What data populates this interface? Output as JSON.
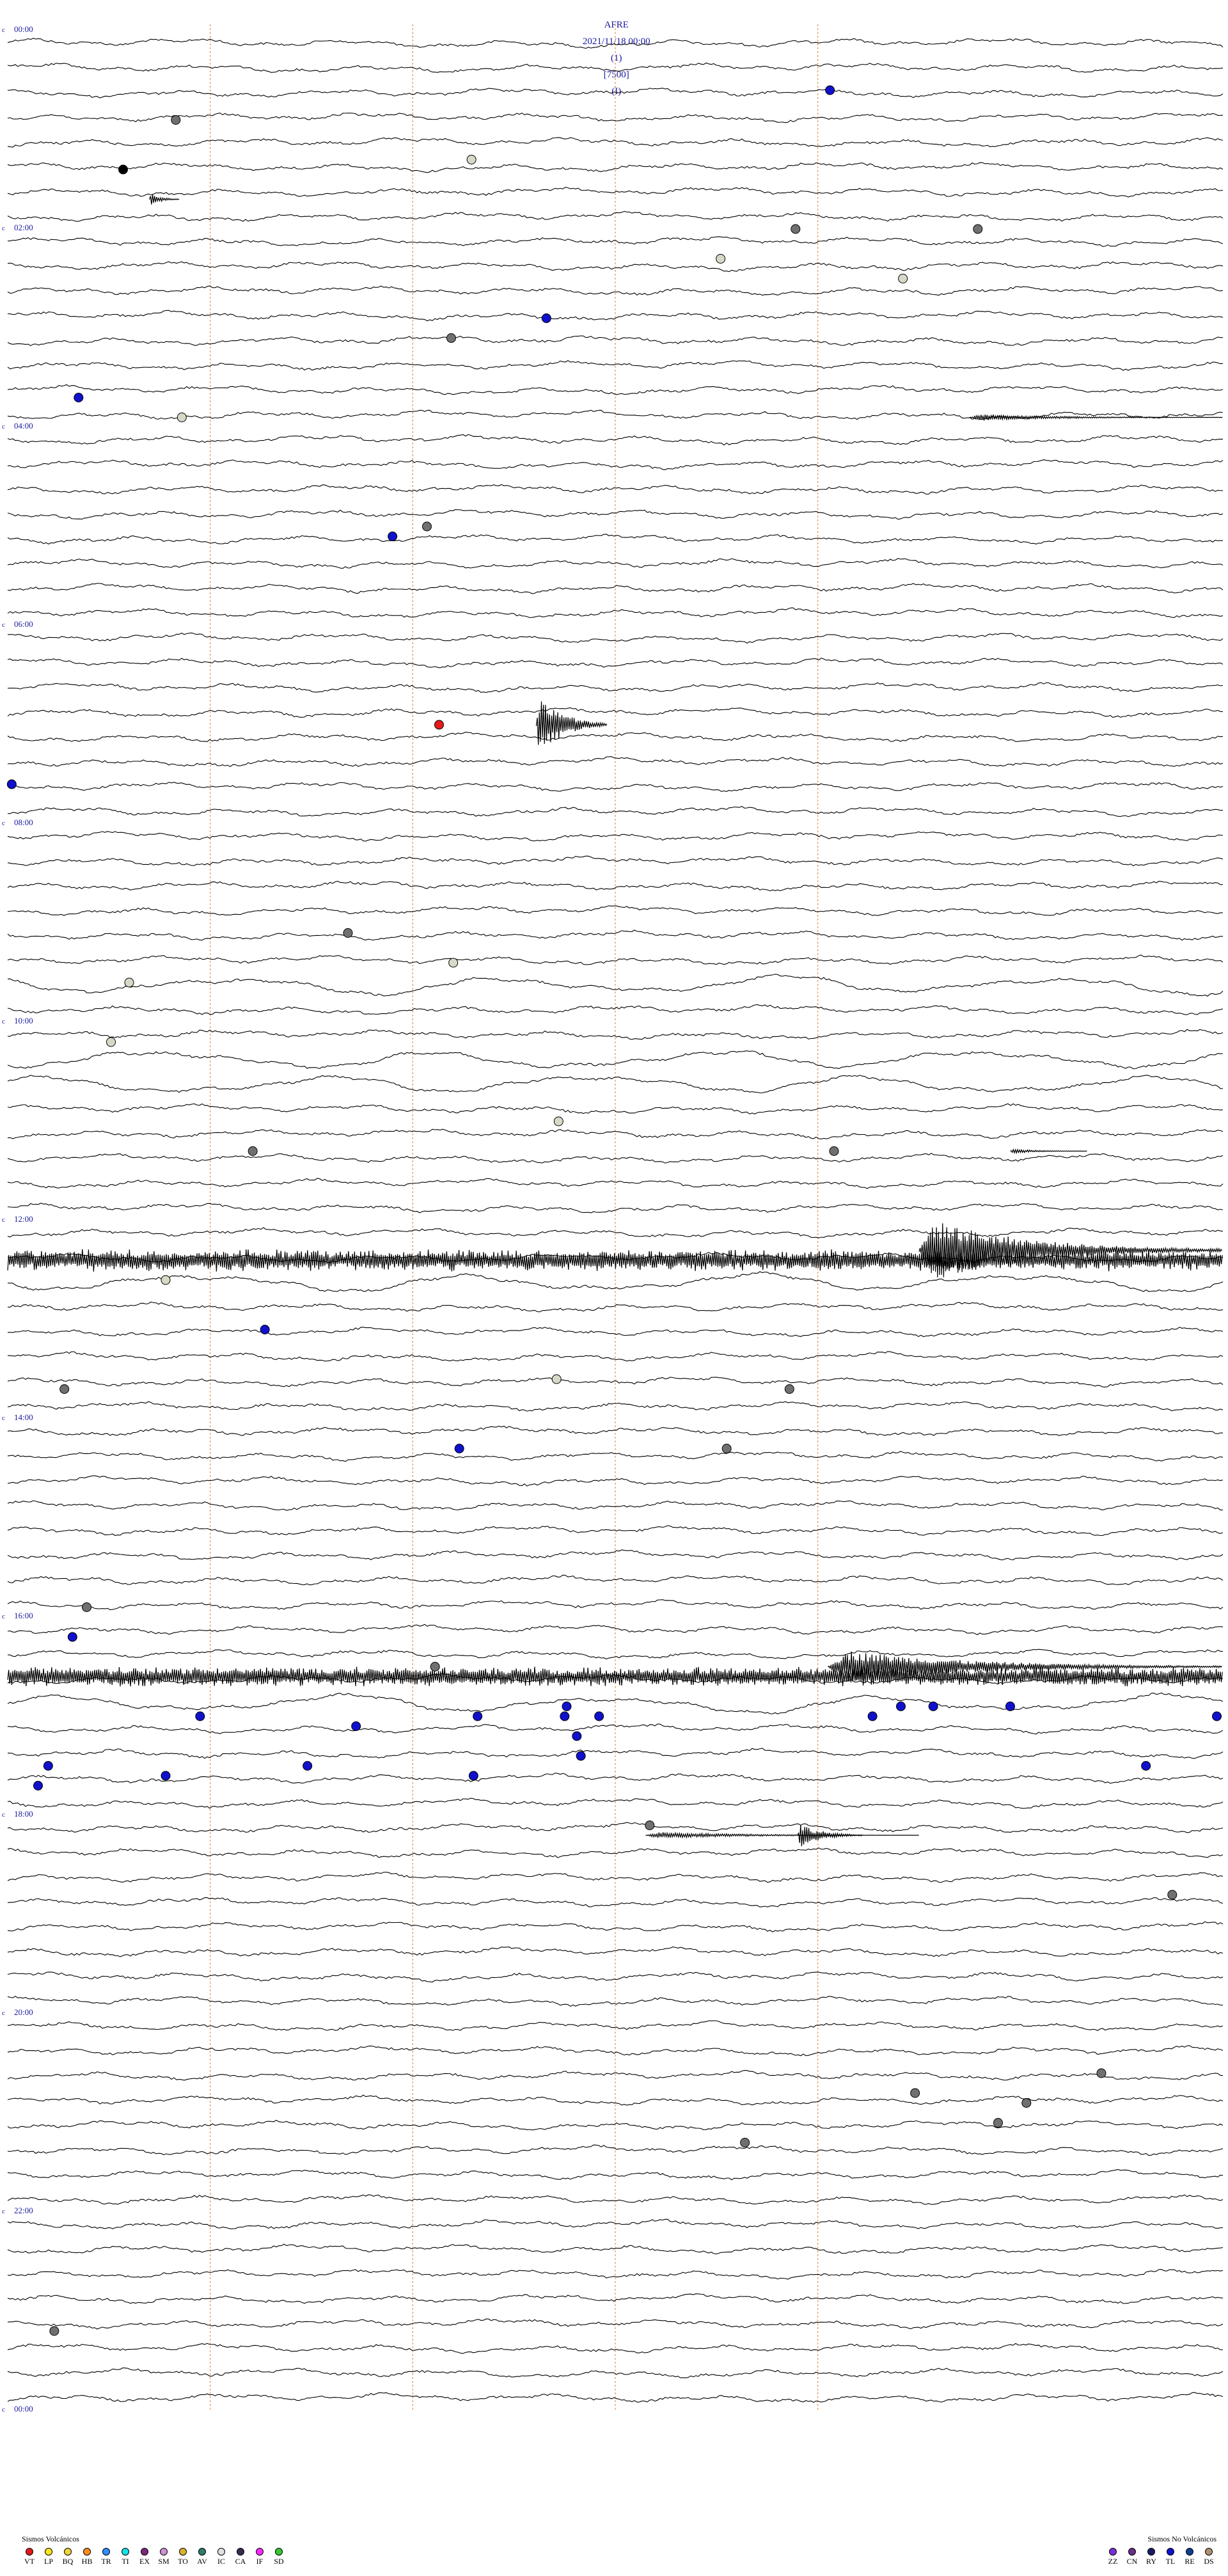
{
  "header": {
    "station": "AFRE",
    "datetime": "2021/11/18 00:00",
    "channel": "(1)",
    "scale": "[7500]",
    "mode": "(I)"
  },
  "chart_data": {
    "type": "helicorder",
    "title": "AFRE 2021/11/18 00:00 (1) [7500] (I)",
    "hour_labels": [
      "00:00",
      "02:00",
      "04:00",
      "06:00",
      "08:00",
      "10:00",
      "12:00",
      "14:00",
      "16:00",
      "18:00",
      "20:00",
      "22:00",
      "00:00"
    ],
    "x_range_minutes": [
      0,
      60
    ],
    "minute_markers": [
      10,
      20,
      30,
      40
    ],
    "trace_count": 96,
    "events": [
      {
        "hour": 0.6,
        "minute": 40.6,
        "class": "TL"
      },
      {
        "hour": 0.9,
        "minute": 8.3,
        "class": "DS"
      },
      {
        "hour": 1.3,
        "minute": 22.9,
        "class": "IC"
      },
      {
        "hour": 1.4,
        "minute": 5.7,
        "class": "EVT"
      },
      {
        "hour": 2.0,
        "minute": 47.9,
        "class": "DS"
      },
      {
        "hour": 2.0,
        "minute": 38.9,
        "class": "DS"
      },
      {
        "hour": 2.3,
        "minute": 35.2,
        "class": "IC"
      },
      {
        "hour": 2.5,
        "minute": 44.2,
        "class": "IC"
      },
      {
        "hour": 2.9,
        "minute": 26.6,
        "class": "TL"
      },
      {
        "hour": 3.1,
        "minute": 21.9,
        "class": "DS"
      },
      {
        "hour": 3.7,
        "minute": 3.5,
        "class": "TL"
      },
      {
        "hour": 3.9,
        "minute": 8.6,
        "class": "IC"
      },
      {
        "hour": 5.0,
        "minute": 20.7,
        "class": "DS"
      },
      {
        "hour": 5.1,
        "minute": 19.0,
        "class": "TL"
      },
      {
        "hour": 7.0,
        "minute": 21.3,
        "class": "VT"
      },
      {
        "hour": 7.6,
        "minute": 0.2,
        "class": "TL"
      },
      {
        "hour": 9.1,
        "minute": 16.8,
        "class": "DS"
      },
      {
        "hour": 9.4,
        "minute": 22.0,
        "class": "IC"
      },
      {
        "hour": 9.6,
        "minute": 6.0,
        "class": "IC"
      },
      {
        "hour": 10.2,
        "minute": 5.1,
        "class": "IC"
      },
      {
        "hour": 11.0,
        "minute": 27.2,
        "class": "IC"
      },
      {
        "hour": 11.3,
        "minute": 12.1,
        "class": "DS"
      },
      {
        "hour": 11.3,
        "minute": 40.8,
        "class": "DS"
      },
      {
        "hour": 12.6,
        "minute": 7.8,
        "class": "IC"
      },
      {
        "hour": 13.1,
        "minute": 12.7,
        "class": "TL"
      },
      {
        "hour": 13.6,
        "minute": 27.1,
        "class": "IC"
      },
      {
        "hour": 13.7,
        "minute": 2.8,
        "class": "DS"
      },
      {
        "hour": 13.7,
        "minute": 38.6,
        "class": "DS"
      },
      {
        "hour": 14.3,
        "minute": 22.3,
        "class": "TL"
      },
      {
        "hour": 14.3,
        "minute": 35.5,
        "class": "DS"
      },
      {
        "hour": 15.9,
        "minute": 3.9,
        "class": "DS"
      },
      {
        "hour": 16.2,
        "minute": 3.2,
        "class": "TL"
      },
      {
        "hour": 16.5,
        "minute": 21.1,
        "class": "DS"
      },
      {
        "hour": 16.9,
        "minute": 27.6,
        "class": "TL"
      },
      {
        "hour": 16.9,
        "minute": 44.1,
        "class": "TL"
      },
      {
        "hour": 16.9,
        "minute": 45.7,
        "class": "TL"
      },
      {
        "hour": 16.9,
        "minute": 49.5,
        "class": "TL"
      },
      {
        "hour": 17.0,
        "minute": 9.5,
        "class": "TL"
      },
      {
        "hour": 17.0,
        "minute": 23.2,
        "class": "TL"
      },
      {
        "hour": 17.0,
        "minute": 27.5,
        "class": "TL"
      },
      {
        "hour": 17.0,
        "minute": 29.2,
        "class": "TL"
      },
      {
        "hour": 17.0,
        "minute": 42.7,
        "class": "TL"
      },
      {
        "hour": 17.0,
        "minute": 59.7,
        "class": "TL"
      },
      {
        "hour": 17.1,
        "minute": 17.2,
        "class": "TL"
      },
      {
        "hour": 17.2,
        "minute": 28.1,
        "class": "TL"
      },
      {
        "hour": 17.4,
        "minute": 28.3,
        "class": "TL"
      },
      {
        "hour": 17.5,
        "minute": 2.0,
        "class": "TL"
      },
      {
        "hour": 17.5,
        "minute": 14.8,
        "class": "TL"
      },
      {
        "hour": 17.5,
        "minute": 56.2,
        "class": "TL"
      },
      {
        "hour": 17.6,
        "minute": 7.8,
        "class": "TL"
      },
      {
        "hour": 17.6,
        "minute": 23.0,
        "class": "TL"
      },
      {
        "hour": 17.7,
        "minute": 1.5,
        "class": "TL"
      },
      {
        "hour": 18.1,
        "minute": 31.7,
        "class": "DS"
      },
      {
        "hour": 18.8,
        "minute": 57.5,
        "class": "DS"
      },
      {
        "hour": 20.6,
        "minute": 54.0,
        "class": "DS"
      },
      {
        "hour": 20.8,
        "minute": 44.8,
        "class": "DS"
      },
      {
        "hour": 20.9,
        "minute": 50.3,
        "class": "DS"
      },
      {
        "hour": 21.1,
        "minute": 48.9,
        "class": "DS"
      },
      {
        "hour": 21.3,
        "minute": 36.4,
        "class": "DS"
      },
      {
        "hour": 23.2,
        "minute": 2.3,
        "class": "DS"
      }
    ],
    "bursts": [
      {
        "hour": 1.7,
        "minute": 7.0,
        "duration": 1.5,
        "amp": 12
      },
      {
        "hour": 3.9,
        "minute": 47.5,
        "duration": 12.5,
        "amp": 6
      },
      {
        "hour": 7.0,
        "minute": 26.1,
        "duration": 3.5,
        "amp": 60
      },
      {
        "hour": 11.3,
        "minute": 49.5,
        "duration": 3.8,
        "amp": 4
      },
      {
        "hour": 12.4,
        "minute": 0.0,
        "duration": 60.0,
        "amp": 18
      },
      {
        "hour": 12.3,
        "minute": 45.0,
        "duration": 15.0,
        "amp": 55
      },
      {
        "hour": 16.6,
        "minute": 0.0,
        "duration": 60.0,
        "amp": 16
      },
      {
        "hour": 16.5,
        "minute": 40.5,
        "duration": 19.5,
        "amp": 30
      },
      {
        "hour": 18.2,
        "minute": 31.5,
        "duration": 13.5,
        "amp": 6
      },
      {
        "hour": 18.2,
        "minute": 39.0,
        "duration": 3.2,
        "amp": 22
      }
    ],
    "long_period_hours": [
      9.6,
      10.2,
      10.4,
      12.5,
      16.8
    ]
  },
  "legend": {
    "volcanic": {
      "title": "Sismos Volcánicos",
      "items": [
        {
          "code": "VT",
          "color": "#e41a1c"
        },
        {
          "code": "LP",
          "color": "#ffe619"
        },
        {
          "code": "BQ",
          "color": "#f0d33a"
        },
        {
          "code": "HB",
          "color": "#ff8a1c"
        },
        {
          "code": "TR",
          "color": "#2f8dff"
        },
        {
          "code": "TI",
          "color": "#18e0e6"
        },
        {
          "code": "EX",
          "color": "#7b2a80"
        },
        {
          "code": "SM",
          "color": "#cf8fd6"
        },
        {
          "code": "TO",
          "color": "#d8b32f"
        },
        {
          "code": "AV",
          "color": "#2e7b6a"
        },
        {
          "code": "IC",
          "color": "#e0e0e0"
        },
        {
          "code": "CA",
          "color": "#3b2a4f"
        },
        {
          "code": "IF",
          "color": "#ff26ff"
        },
        {
          "code": "SD",
          "color": "#35c835"
        }
      ]
    },
    "non_volcanic": {
      "title": "Sismos No Volcánicos",
      "items": [
        {
          "code": "ZZ",
          "color": "#7b2fd6"
        },
        {
          "code": "CN",
          "color": "#6a2f88"
        },
        {
          "code": "RY",
          "color": "#1a1a6a"
        },
        {
          "code": "TL",
          "color": "#1111cc"
        },
        {
          "code": "RE",
          "color": "#0f3d8f"
        },
        {
          "code": "DS",
          "color": "#b09070"
        }
      ]
    }
  },
  "colors": {
    "trace": "#000000",
    "hour_label": "#1a1aa0",
    "minute_marker": "#e08030",
    "event_outline": "#000000",
    "event_gray": "#707070",
    "event_icgray": "#d8d8c8"
  }
}
